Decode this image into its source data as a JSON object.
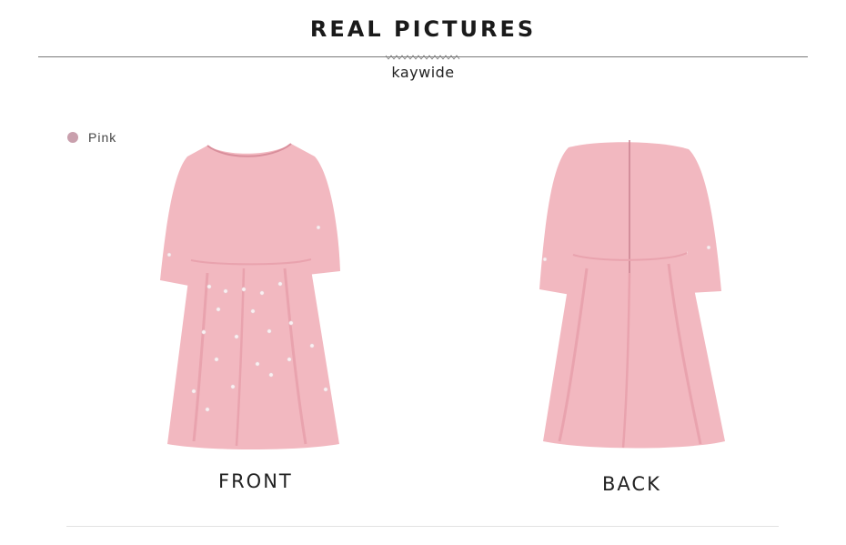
{
  "header": {
    "title": "REAL PICTURES",
    "brand": "kaywide"
  },
  "color_option": {
    "label": "Pink",
    "swatch_color": "#c9a0ad"
  },
  "views": {
    "front_caption": "FRONT",
    "back_caption": "BACK"
  },
  "colors": {
    "dress_main": "#f2b8c0",
    "dress_shadow": "#e9a3ae",
    "pearl": "#faf0f2"
  }
}
